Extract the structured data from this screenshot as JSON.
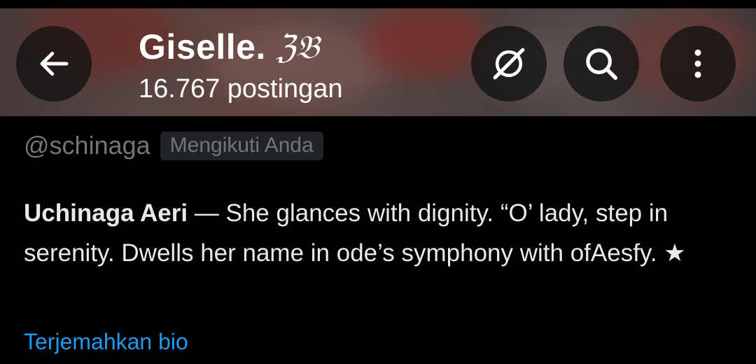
{
  "header": {
    "display_name": "Giselle.",
    "name_emoji": "ℨ𝔅",
    "post_count": "16.767 postingan",
    "back_icon": "arrow-left-icon",
    "grok_icon": "grok-icon",
    "search_icon": "search-icon",
    "more_icon": "more-vertical-icon"
  },
  "profile": {
    "handle": "@schinaga",
    "follows_you": "Mengikuti Anda",
    "bio_name": "Uchinaga Aeri",
    "bio_text": " — She glances with dignity. “O’ lady, step in serenity. Dwells her name in ode’s symphony with ofAesfy. ★",
    "translate_bio": "Terjemahkan bio"
  },
  "colors": {
    "background": "#000000",
    "text": "#e7e9ea",
    "secondary": "#71767b",
    "link": "#1d9bf0"
  }
}
